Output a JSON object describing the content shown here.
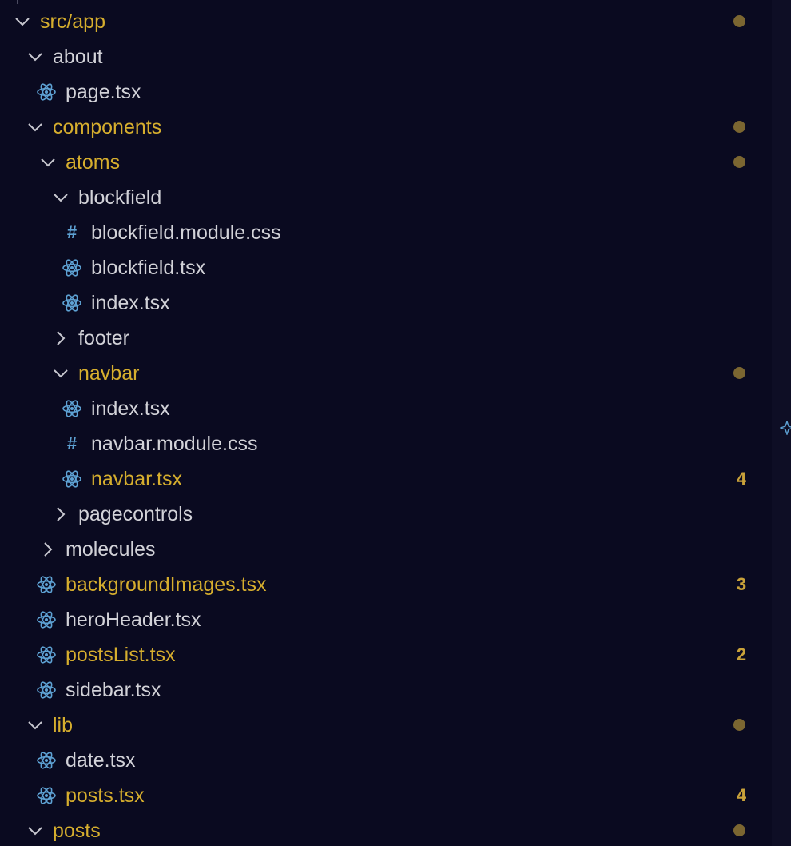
{
  "explorer": {
    "rows": [
      {
        "label": "src/app",
        "kind": "folder",
        "expanded": true,
        "modified": true,
        "indicator": "dot"
      },
      {
        "label": "about",
        "kind": "folder",
        "expanded": true,
        "modified": false
      },
      {
        "label": "page.tsx",
        "kind": "react-file",
        "modified": false
      },
      {
        "label": "components",
        "kind": "folder",
        "expanded": true,
        "modified": true,
        "indicator": "dot"
      },
      {
        "label": "atoms",
        "kind": "folder",
        "expanded": true,
        "modified": true,
        "indicator": "dot"
      },
      {
        "label": "blockfield",
        "kind": "folder",
        "expanded": true,
        "modified": false
      },
      {
        "label": "blockfield.module.css",
        "kind": "css-file",
        "modified": false
      },
      {
        "label": "blockfield.tsx",
        "kind": "react-file",
        "modified": false
      },
      {
        "label": "index.tsx",
        "kind": "react-file",
        "modified": false
      },
      {
        "label": "footer",
        "kind": "folder",
        "expanded": false,
        "modified": false
      },
      {
        "label": "navbar",
        "kind": "folder",
        "expanded": true,
        "modified": true,
        "indicator": "dot"
      },
      {
        "label": "index.tsx",
        "kind": "react-file",
        "modified": false
      },
      {
        "label": "navbar.module.css",
        "kind": "css-file",
        "modified": false
      },
      {
        "label": "navbar.tsx",
        "kind": "react-file",
        "modified": true,
        "badge": "4"
      },
      {
        "label": "pagecontrols",
        "kind": "folder",
        "expanded": false,
        "modified": false
      },
      {
        "label": "molecules",
        "kind": "folder",
        "expanded": false,
        "modified": false
      },
      {
        "label": "backgroundImages.tsx",
        "kind": "react-file",
        "modified": true,
        "badge": "3"
      },
      {
        "label": "heroHeader.tsx",
        "kind": "react-file",
        "modified": false
      },
      {
        "label": "postsList.tsx",
        "kind": "react-file",
        "modified": true,
        "badge": "2"
      },
      {
        "label": "sidebar.tsx",
        "kind": "react-file",
        "modified": false
      },
      {
        "label": "lib",
        "kind": "folder",
        "expanded": true,
        "modified": true,
        "indicator": "dot"
      },
      {
        "label": "date.tsx",
        "kind": "react-file",
        "modified": false
      },
      {
        "label": "posts.tsx",
        "kind": "react-file",
        "modified": true,
        "badge": "4"
      },
      {
        "label": "posts",
        "kind": "folder",
        "expanded": true,
        "modified": true,
        "indicator": "dot"
      }
    ]
  },
  "colors": {
    "background": "#0a0a20",
    "text": "#d2d2d8",
    "modified_text": "#d6ae2e",
    "modified_dot": "#7b6631",
    "badge": "#c9a23a",
    "react_icon": "#5ea2d4",
    "css_icon": "#5ea2d4",
    "chevron": "#c8c8d0"
  },
  "icons": {
    "folder_expanded": "chevron-down-icon",
    "folder_collapsed": "chevron-right-icon",
    "react_file": "react-icon",
    "css_file": "hash-icon",
    "gutter": "sparkle-icon"
  }
}
